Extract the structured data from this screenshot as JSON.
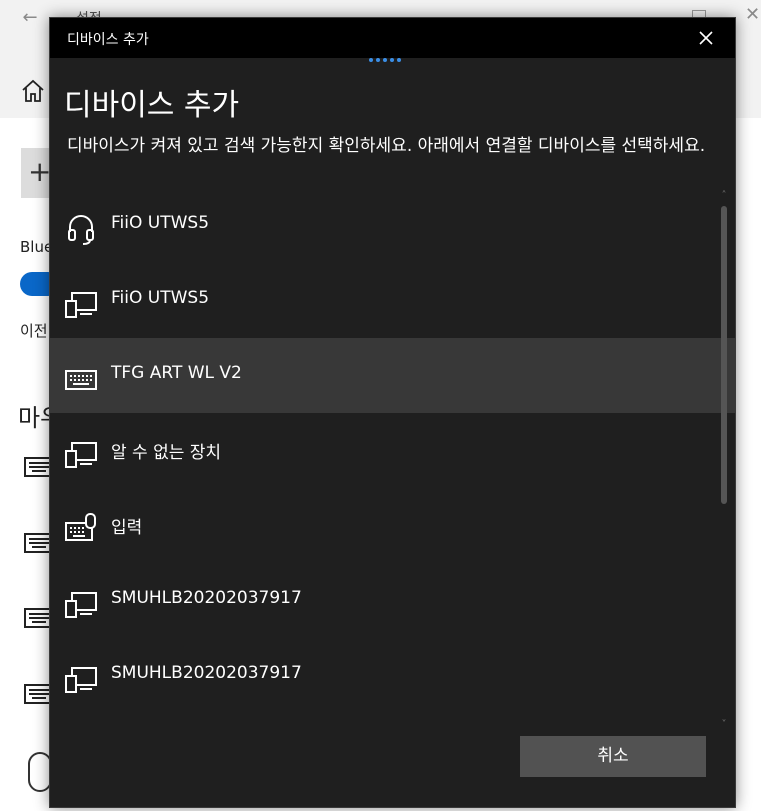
{
  "background": {
    "title": "설정",
    "bluetooth_label": "Blue",
    "other_label": "이전",
    "section_label": "마우"
  },
  "dialog": {
    "title": "디바이스 추가",
    "heading": "디바이스 추가",
    "instruction": "디바이스가 켜져 있고 검색 가능한지 확인하세요. 아래에서 연결할 디바이스를 선택하세요.",
    "cancel_label": "취소",
    "accent_color": "#3a8ee6"
  },
  "devices": [
    {
      "label": "FiiO UTWS5",
      "icon": "headset-icon",
      "selected": false
    },
    {
      "label": "FiiO UTWS5",
      "icon": "display-device-icon",
      "selected": false
    },
    {
      "label": "TFG ART WL V2",
      "icon": "keyboard-icon",
      "selected": true
    },
    {
      "label": "알 수 없는 장치",
      "icon": "display-device-icon",
      "selected": false
    },
    {
      "label": "입력",
      "icon": "keyboard-mouse-icon",
      "selected": false
    },
    {
      "label": "SMUHLB20202037917",
      "icon": "display-device-icon",
      "selected": false
    },
    {
      "label": "SMUHLB20202037917",
      "icon": "display-device-icon",
      "selected": false
    }
  ]
}
